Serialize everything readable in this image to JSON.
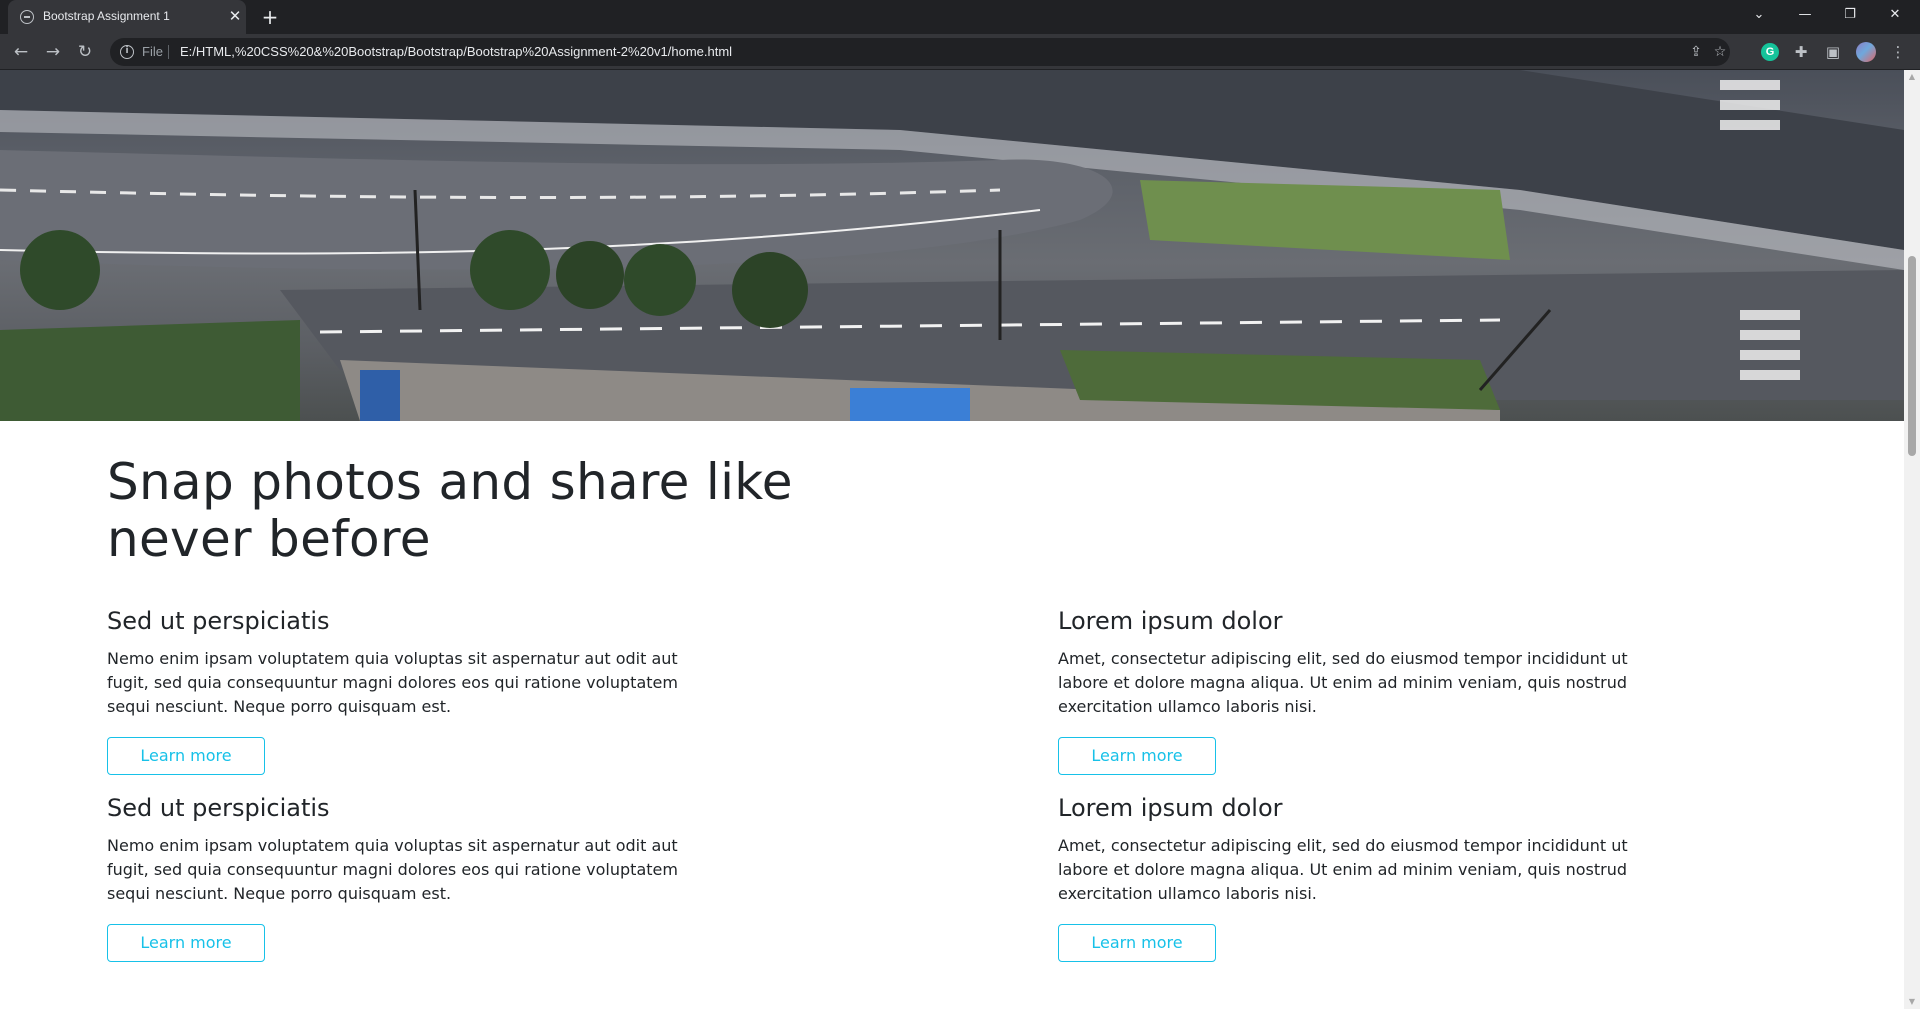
{
  "browser": {
    "tab_title": "Bootstrap Assignment 1",
    "tab_close_glyph": "✕",
    "new_tab_glyph": "+",
    "url_scheme": "File",
    "url": "E:/HTML,%20CSS%20&%20Bootstrap/Bootstrap/Bootstrap%20Assignment-2%20v1/home.html",
    "extension_badge": "G"
  },
  "page": {
    "headline": "Snap photos and share like never before",
    "features": [
      {
        "title": "Sed ut perspiciatis",
        "text": "Nemo enim ipsam voluptatem quia voluptas sit aspernatur aut odit aut fugit, sed quia consequuntur magni dolores eos qui ratione voluptatem sequi nesciunt. Neque porro quisquam est.",
        "button": "Learn more"
      },
      {
        "title": "Lorem ipsum dolor",
        "text": "Amet, consectetur adipiscing elit, sed do eiusmod tempor incididunt ut labore et dolore magna aliqua. Ut enim ad minim veniam, quis nostrud exercitation ullamco laboris nisi.",
        "button": "Learn more"
      },
      {
        "title": "Sed ut perspiciatis",
        "text": "Nemo enim ipsam voluptatem quia voluptas sit aspernatur aut odit aut fugit, sed quia consequuntur magni dolores eos qui ratione voluptatem sequi nesciunt. Neque porro quisquam est.",
        "button": "Learn more"
      },
      {
        "title": "Lorem ipsum dolor",
        "text": "Amet, consectetur adipiscing elit, sed do eiusmod tempor incididunt ut labore et dolore magna aliqua. Ut enim ad minim veniam, quis nostrud exercitation ullamco laboris nisi.",
        "button": "Learn more"
      }
    ]
  },
  "colors": {
    "accent": "#17c1e8",
    "text": "#212529",
    "chrome_dark": "#202124",
    "chrome_tab": "#35363a"
  }
}
